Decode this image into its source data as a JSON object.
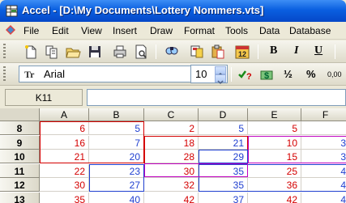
{
  "window": {
    "title": "Accel - [D:\\My Documents\\Lottery Nommers.vts]"
  },
  "menu": [
    "File",
    "Edit",
    "View",
    "Insert",
    "Draw",
    "Format",
    "Tools",
    "Data",
    "Database"
  ],
  "toolbar1": {
    "icons": [
      "new-icon",
      "copy-doc-icon",
      "open-icon",
      "save-icon",
      "print-icon",
      "print-preview-icon",
      "find-icon",
      "cut-icon",
      "paste-icon",
      "calendar-icon"
    ],
    "calendar_label": "12",
    "bold_label": "B",
    "italic_label": "I",
    "underline_label": "U"
  },
  "toolbar2": {
    "font_icon_label": "Tr",
    "font_name": "Arial",
    "font_size": "10",
    "currency_label": "$",
    "fraction_label": "½",
    "percent_label": "%",
    "decimal_label": "0,00"
  },
  "refbar": {
    "cell_ref": "K11",
    "formula": ""
  },
  "colors": {
    "red": "#d40000",
    "blue": "#1f3fd0",
    "magenta": "#c000c0",
    "title_bar": "#0a5fe0"
  },
  "sheet": {
    "columns": [
      "A",
      "B",
      "C",
      "D",
      "E",
      "F"
    ],
    "rows": [
      {
        "label": "8",
        "cells": [
          {
            "v": "6",
            "c": "red"
          },
          {
            "v": "5",
            "c": "blue"
          },
          {
            "v": "2",
            "c": "red"
          },
          {
            "v": "5",
            "c": "blue"
          },
          {
            "v": "5",
            "c": "red"
          },
          {
            "v": "",
            "c": "blue"
          }
        ]
      },
      {
        "label": "9",
        "cells": [
          {
            "v": "16",
            "c": "red"
          },
          {
            "v": "7",
            "c": "blue"
          },
          {
            "v": "18",
            "c": "red"
          },
          {
            "v": "21",
            "c": "blue"
          },
          {
            "v": "10",
            "c": "red"
          },
          {
            "v": "3",
            "c": "blue"
          }
        ]
      },
      {
        "label": "10",
        "cells": [
          {
            "v": "21",
            "c": "red"
          },
          {
            "v": "20",
            "c": "blue"
          },
          {
            "v": "28",
            "c": "red"
          },
          {
            "v": "29",
            "c": "blue"
          },
          {
            "v": "15",
            "c": "red"
          },
          {
            "v": "3",
            "c": "blue"
          }
        ]
      },
      {
        "label": "11",
        "cells": [
          {
            "v": "22",
            "c": "red"
          },
          {
            "v": "23",
            "c": "blue"
          },
          {
            "v": "30",
            "c": "red"
          },
          {
            "v": "35",
            "c": "blue"
          },
          {
            "v": "25",
            "c": "red"
          },
          {
            "v": "4",
            "c": "blue"
          }
        ]
      },
      {
        "label": "12",
        "cells": [
          {
            "v": "30",
            "c": "red"
          },
          {
            "v": "27",
            "c": "blue"
          },
          {
            "v": "32",
            "c": "red"
          },
          {
            "v": "35",
            "c": "blue"
          },
          {
            "v": "36",
            "c": "red"
          },
          {
            "v": "4",
            "c": "blue"
          }
        ]
      },
      {
        "label": "13",
        "cells": [
          {
            "v": "35",
            "c": "red"
          },
          {
            "v": "40",
            "c": "blue"
          },
          {
            "v": "42",
            "c": "red"
          },
          {
            "v": "37",
            "c": "blue"
          },
          {
            "v": "42",
            "c": "red"
          },
          {
            "v": "4",
            "c": "blue"
          }
        ]
      }
    ]
  }
}
